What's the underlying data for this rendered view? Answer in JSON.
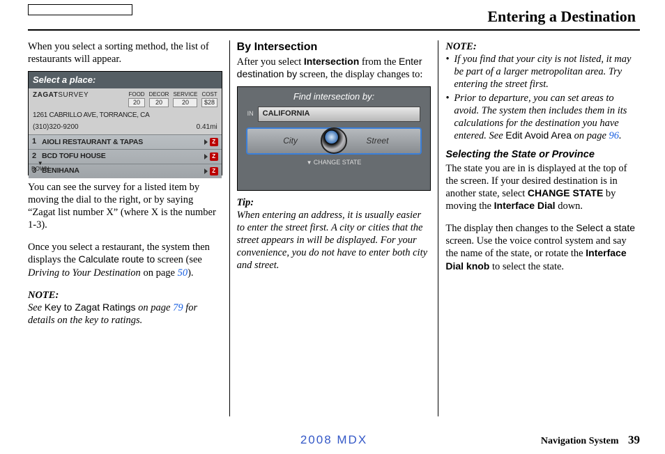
{
  "header": {
    "title": "Entering a Destination"
  },
  "col1": {
    "p1": "When you select a sorting method, the list of restaurants will appear.",
    "screenshot": {
      "title": "Select a place:",
      "zagat_label": "ZAGAT",
      "zagat_survey": "SURVEY",
      "ratings": [
        {
          "lbl": "FOOD",
          "val": "20"
        },
        {
          "lbl": "DECOR",
          "val": "20"
        },
        {
          "lbl": "SERVICE",
          "val": "20"
        },
        {
          "lbl": "COST",
          "val": "$28"
        }
      ],
      "address": "1261 CABRILLO AVE, TORRANCE, CA",
      "phone": "(310)320-9200",
      "distance": "0.41mi",
      "rows": [
        {
          "n": "1",
          "name": "AIOLI RESTAURANT & TAPAS"
        },
        {
          "n": "2",
          "name": "BCD TOFU HOUSE"
        },
        {
          "n": "3",
          "name": "BENIHANA"
        }
      ],
      "down": "DOWN"
    },
    "p2_a": "You can see the survey for a listed item by moving the dial to the right, or by saying “Zagat list number X” (where X is the number 1-3).",
    "p3_a": "Once you select a restaurant, the system then displays the ",
    "p3_sans": "Calculate route to",
    "p3_b": " screen (see ",
    "p3_i": "Driving to Your Destination",
    "p3_c": " on page ",
    "p3_link": "50",
    "p3_d": ").",
    "note_label": "NOTE:",
    "note_a": "See ",
    "note_sans": "Key to Zagat Ratings",
    "note_b": " on page ",
    "note_link": "79",
    "note_c": " for details on the key to ratings."
  },
  "col2": {
    "heading": "By Intersection",
    "p1_a": "After you select ",
    "p1_b": "Intersection",
    "p1_c": " from the ",
    "p1_sans": "Enter destination by",
    "p1_d": " screen, the display changes to:",
    "screenshot": {
      "title": "Find intersection by:",
      "in_lbl": "IN",
      "in_val": "CALIFORNIA",
      "btn1": "City",
      "btn2": "Street",
      "change": "CHANGE STATE"
    },
    "tip_label": "Tip:",
    "tip_body": "When entering an address, it is usually easier to enter the street first. A city or cities that the street appears in will be displayed. For your convenience, you do not have to enter both city and street."
  },
  "col3": {
    "note_label": "NOTE:",
    "bullets": [
      "If you find that your city is not listed, it may be part of a larger metropolitan area. Try entering the street first."
    ],
    "bullet2_a": "Prior to departure, you can set areas to avoid. The system then includes them in its calculations for the destination you have entered. See ",
    "bullet2_sans": "Edit Avoid Area",
    "bullet2_b": " on page ",
    "bullet2_link": "96",
    "bullet2_c": ".",
    "heading": "Selecting the State or Province",
    "p1_a": "The state you are in is displayed at the top of the screen. If your desired destination is in another state, select ",
    "p1_b": "CHANGE STATE",
    "p1_c": " by moving the ",
    "p1_d": "Interface Dial",
    "p1_e": " down.",
    "p2_a": "The display then changes to the ",
    "p2_sans": "Select a state",
    "p2_b": " screen. Use the voice control system and say the name of the state, or rotate the ",
    "p2_c": "Interface Dial knob",
    "p2_d": " to select the state."
  },
  "footer": {
    "center": "2008 MDX",
    "right_label": "Navigation System",
    "right_page": "39"
  }
}
